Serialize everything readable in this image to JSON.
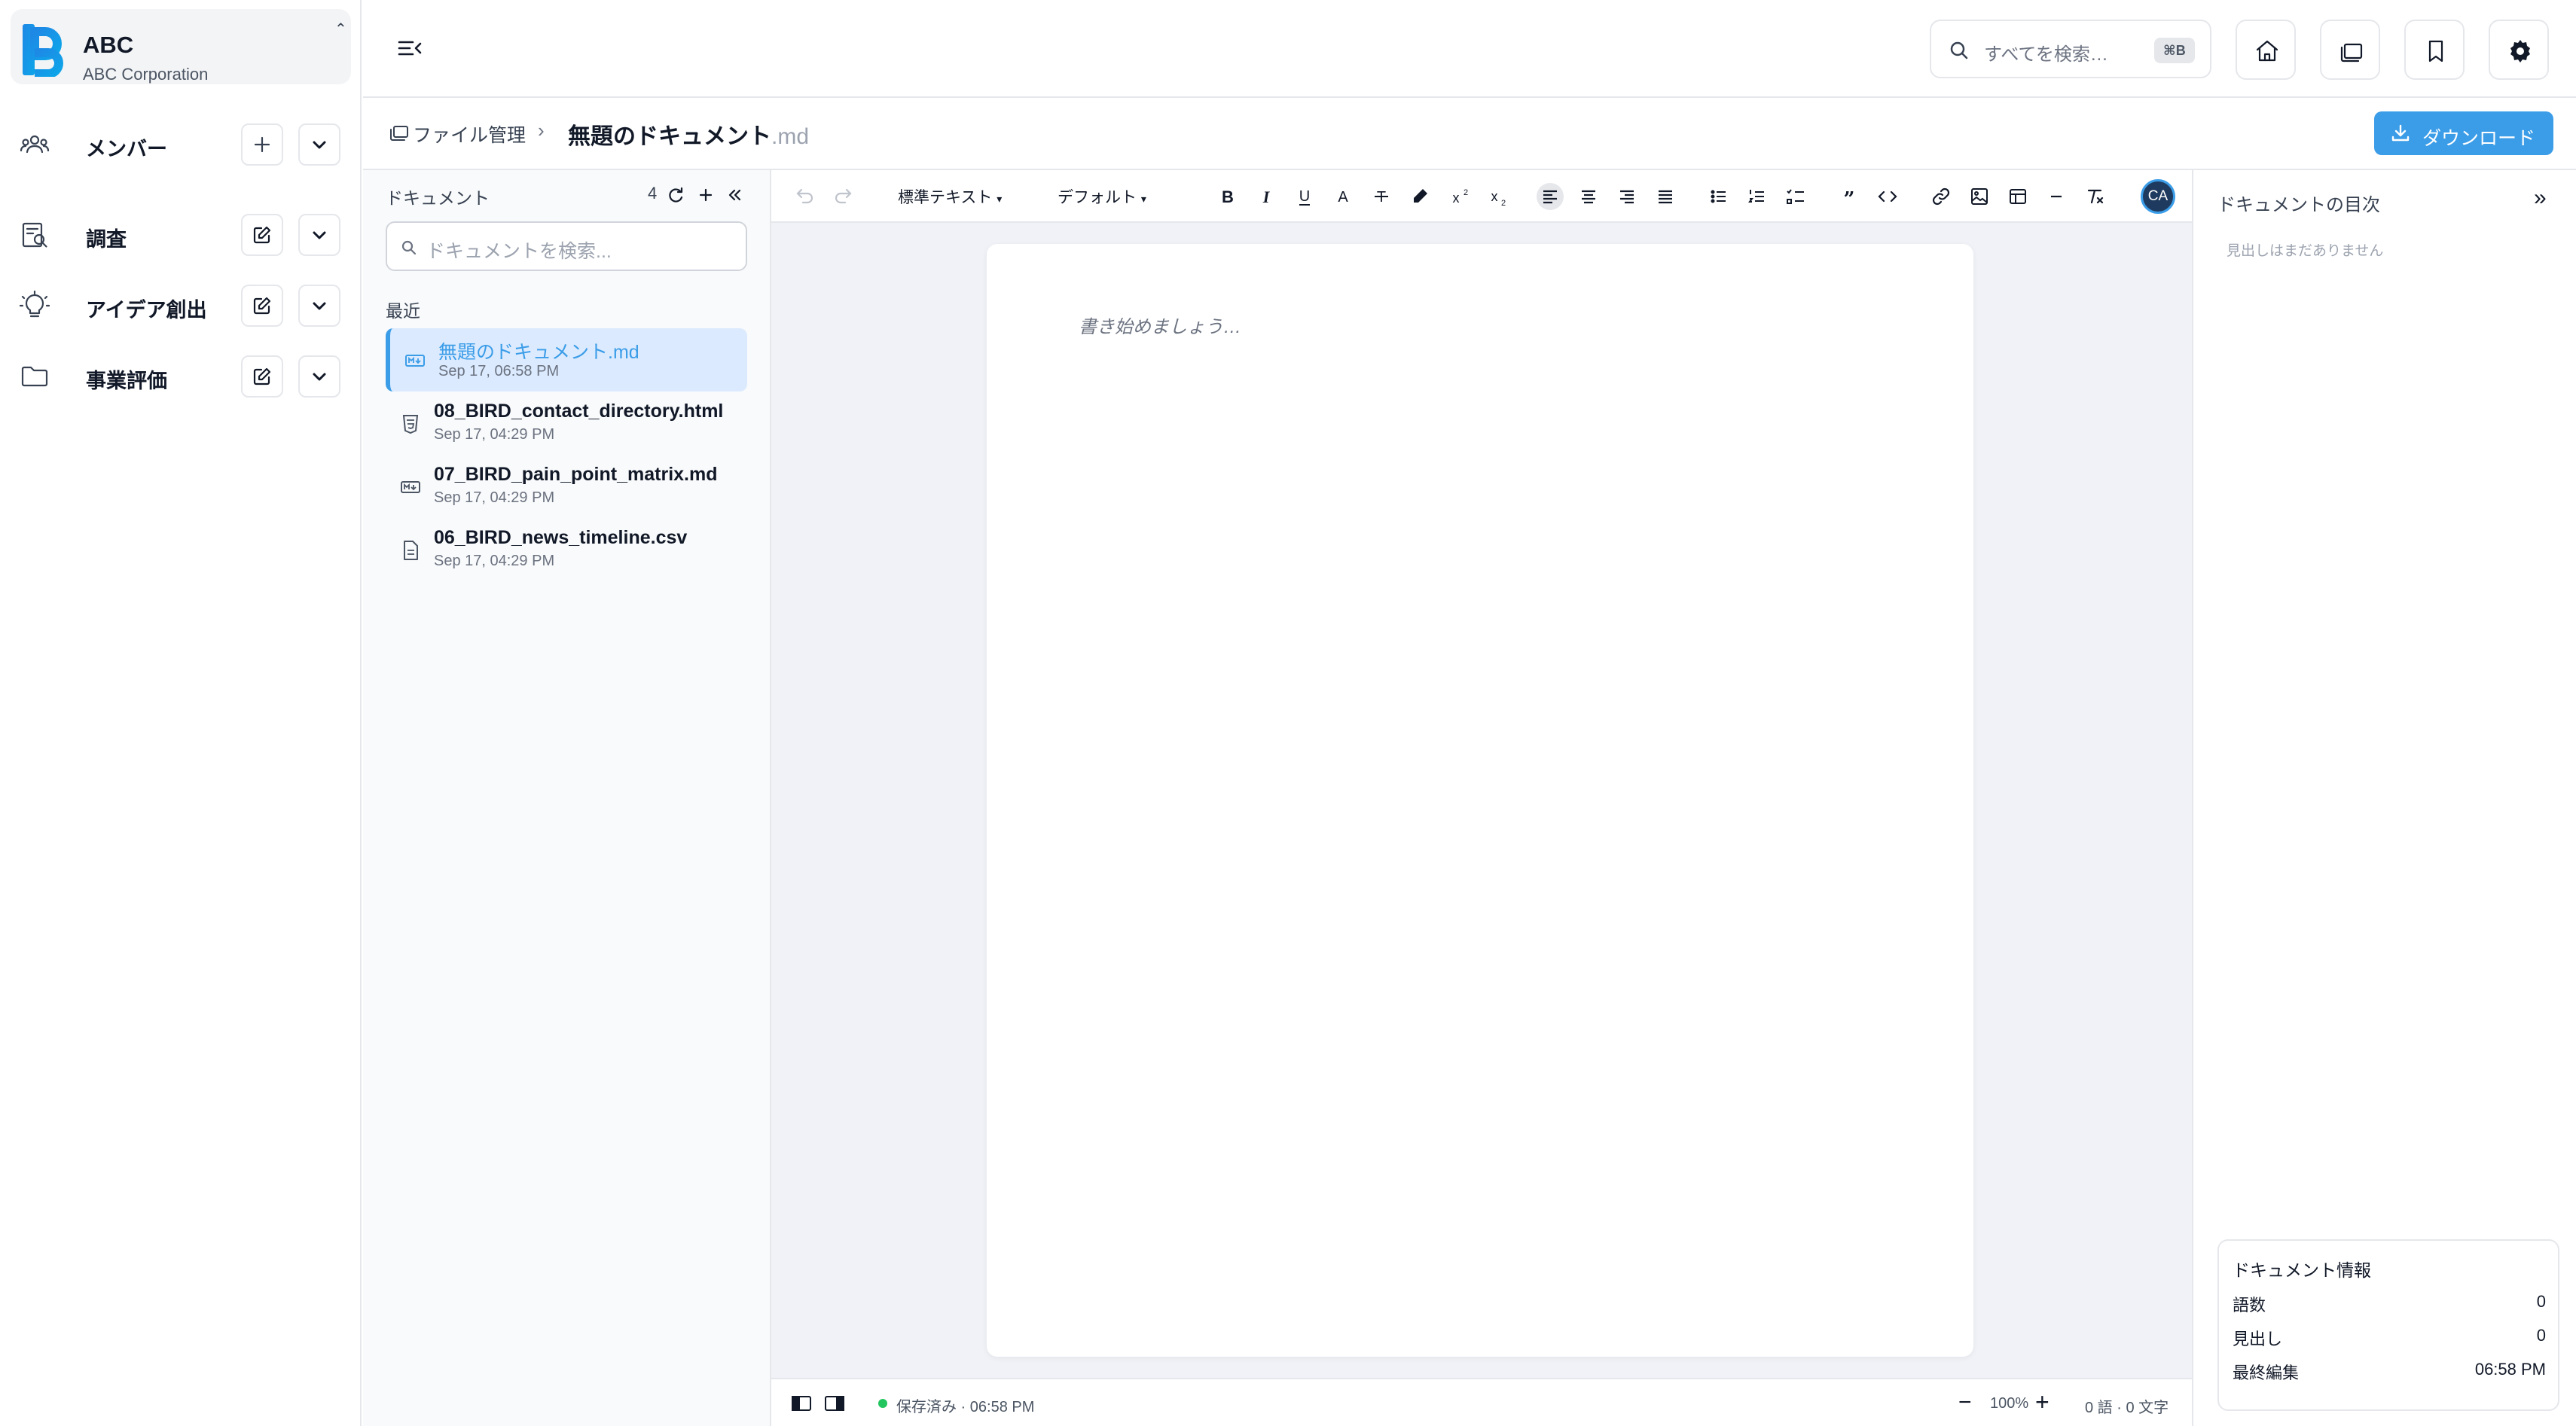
{
  "org": {
    "name": "ABC",
    "subtitle": "ABC Corporation",
    "toggle": "⌃"
  },
  "sidebar": {
    "items": [
      {
        "label": "メンバー",
        "icon": "users-icon"
      },
      {
        "label": "調査",
        "icon": "research-icon"
      },
      {
        "label": "アイデア創出",
        "icon": "lightbulb-icon"
      },
      {
        "label": "事業評価",
        "icon": "folder-icon"
      }
    ]
  },
  "header": {
    "search_placeholder": "すべてを検索…",
    "search_shortcut": "⌘B"
  },
  "breadcrumb": {
    "root": "ファイル管理",
    "separator": "›",
    "title": "無題のドキュメント",
    "ext": ".md",
    "download_label": "ダウンロード"
  },
  "files": {
    "title": "ドキュメント",
    "count": "4",
    "search_placeholder": "ドキュメントを検索...",
    "recent_label": "最近",
    "items": [
      {
        "name": "無題のドキュメント.md",
        "date": "Sep 17, 06:58 PM",
        "type": "markdown"
      },
      {
        "name": "08_BIRD_contact_directory.html",
        "date": "Sep 17, 04:29 PM",
        "type": "html"
      },
      {
        "name": "07_BIRD_pain_point_matrix.md",
        "date": "Sep 17, 04:29 PM",
        "type": "markdown"
      },
      {
        "name": "06_BIRD_news_timeline.csv",
        "date": "Sep 17, 04:29 PM",
        "type": "csv"
      }
    ]
  },
  "editor": {
    "style_select": "標準テキスト",
    "font_select": "デフォルト",
    "avatar": "CA",
    "placeholder": "書き始めましょう…",
    "status": "保存済み · 06:58 PM",
    "zoom": "100%",
    "zoom_minus": "−",
    "zoom_plus": "+",
    "counts": "0 語 · 0 文字"
  },
  "toc": {
    "title": "ドキュメントの目次",
    "collapse": "»",
    "empty": "見出しはまだありません",
    "info_title": "ドキュメント情報",
    "info": [
      {
        "label": "語数",
        "value": "0"
      },
      {
        "label": "見出し",
        "value": "0"
      },
      {
        "label": "最終編集",
        "value": "06:58 PM"
      }
    ]
  },
  "colors": {
    "accent": "#3b9de8",
    "active_bg": "#dbeafe",
    "saved": "#22c55e"
  }
}
